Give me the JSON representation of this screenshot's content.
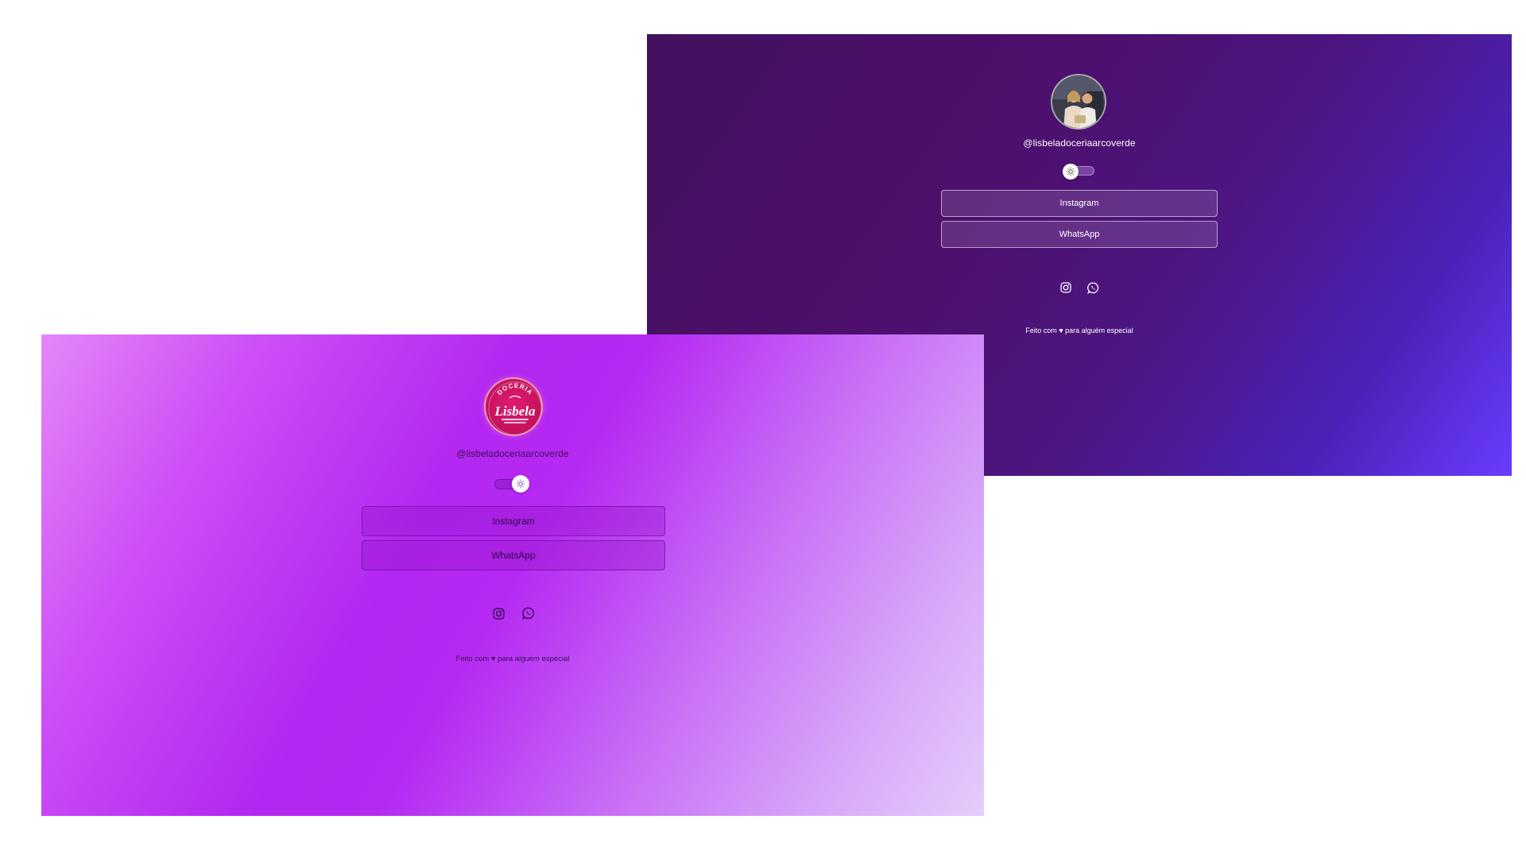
{
  "screens": {
    "dark": {
      "theme": "dark",
      "avatar_icon": "profile-photo-couple",
      "handle": "@lisbeladoceriaarcoverde",
      "theme_toggle": {
        "state": "off",
        "icon": "sun-icon"
      },
      "links": [
        {
          "label": "Instagram"
        },
        {
          "label": "WhatsApp"
        }
      ],
      "social_icons": [
        "instagram-icon",
        "whatsapp-icon"
      ],
      "footer": "Feito com ♥ para alguém especial",
      "colors": {
        "gradient_start": "#43105e",
        "gradient_end": "#6a3cff",
        "text": "#ffffff"
      }
    },
    "light": {
      "theme": "light",
      "avatar_icon": "lisbela-logo",
      "logo_text": {
        "arc": "DOCERIA",
        "name": "Lisbela"
      },
      "handle": "@lisbeladoceriaarcoverde",
      "theme_toggle": {
        "state": "on",
        "icon": "sun-icon"
      },
      "links": [
        {
          "label": "Instagram"
        },
        {
          "label": "WhatsApp"
        }
      ],
      "social_icons": [
        "instagram-icon",
        "whatsapp-icon"
      ],
      "footer": "Feito com ♥ para alguém especial",
      "colors": {
        "gradient_start": "#e487f7",
        "gradient_mid": "#b327f2",
        "gradient_end": "#e4cdfb",
        "text": "#3a1052"
      }
    }
  }
}
